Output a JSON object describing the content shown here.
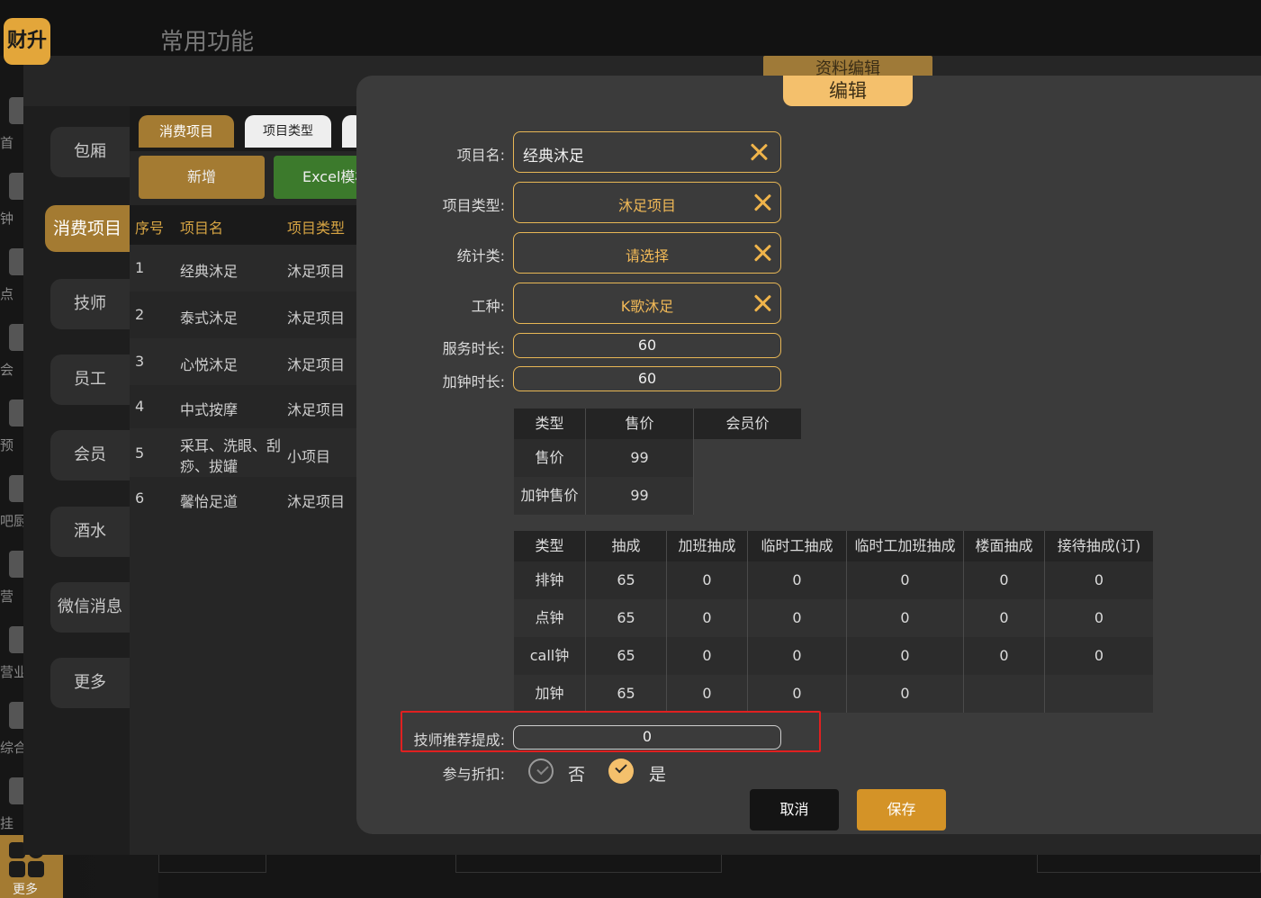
{
  "app": {
    "logo_text": "财升",
    "bg_title": "常用功能",
    "more_label": "更多"
  },
  "left_nav": [
    {
      "label": "首",
      "icon": "home-icon"
    },
    {
      "label": "钟",
      "icon": "bell-icon"
    },
    {
      "label": "点",
      "icon": "order-icon"
    },
    {
      "label": "会",
      "icon": "crown-icon"
    },
    {
      "label": "预",
      "icon": "calendar-icon"
    },
    {
      "label": "吧厨",
      "icon": "chef-icon"
    },
    {
      "label": "营",
      "icon": "chart-icon"
    },
    {
      "label": "营业",
      "icon": "clock-icon"
    },
    {
      "label": "综合",
      "icon": "report-icon"
    },
    {
      "label": "挂",
      "icon": "hang-icon"
    }
  ],
  "categories": [
    "包厢",
    "消费项目",
    "技师",
    "员工",
    "会员",
    "酒水",
    "微信消息",
    "更多"
  ],
  "tabs": {
    "consume": "消费项目",
    "type": "项目类型"
  },
  "toolbar": {
    "add": "新增",
    "excel": "Excel模板"
  },
  "table": {
    "headers": [
      "序号",
      "项目名",
      "项目类型"
    ],
    "rows": [
      {
        "no": "1",
        "name": "经典沐足",
        "type": "沐足项目"
      },
      {
        "no": "2",
        "name": "泰式沐足",
        "type": "沐足项目"
      },
      {
        "no": "3",
        "name": "心悦沐足",
        "type": "沐足项目"
      },
      {
        "no": "4",
        "name": "中式按摩",
        "type": "沐足项目"
      },
      {
        "no": "5",
        "name_line1": "采耳、洗眼、刮",
        "name_line2": "痧、拔罐",
        "type": "小项目"
      },
      {
        "no": "6",
        "name": "馨怡足道",
        "type": "沐足项目"
      }
    ]
  },
  "modal": {
    "old_tab": "资料编辑",
    "tab": "编辑",
    "fields": {
      "name": {
        "label": "项目名:",
        "value": "经典沐足"
      },
      "type": {
        "label": "项目类型:",
        "value": "沐足项目"
      },
      "stat": {
        "label": "统计类:",
        "value": "请选择"
      },
      "work": {
        "label": "工种:",
        "value": "K歌沐足"
      },
      "duration": {
        "label": "服务时长:",
        "value": "60"
      },
      "extra": {
        "label": "加钟时长:",
        "value": "60"
      },
      "recommend": {
        "label": "技师推荐提成:",
        "value": "0"
      },
      "discount": {
        "label": "参与折扣:",
        "no": "否",
        "yes": "是"
      }
    },
    "price_table": {
      "headers": [
        "类型",
        "售价",
        "会员价"
      ],
      "rows": [
        [
          "售价",
          "99",
          ""
        ],
        [
          "加钟售价",
          "99",
          ""
        ]
      ]
    },
    "comm_table": {
      "headers": [
        "类型",
        "抽成",
        "加班抽成",
        "临时工抽成",
        "临时工加班抽成",
        "楼面抽成",
        "接待抽成(订)"
      ],
      "rows": [
        [
          "排钟",
          "65",
          "0",
          "0",
          "0",
          "0",
          "0"
        ],
        [
          "点钟",
          "65",
          "0",
          "0",
          "0",
          "0",
          "0"
        ],
        [
          "call钟",
          "65",
          "0",
          "0",
          "0",
          "0",
          "0"
        ],
        [
          "加钟",
          "65",
          "0",
          "0",
          "0",
          "",
          ""
        ]
      ]
    },
    "buttons": {
      "cancel": "取消",
      "save": "保存"
    }
  },
  "colors": {
    "accent": "#e8b755",
    "brand": "#a47b32",
    "highlight": "#e02020"
  }
}
